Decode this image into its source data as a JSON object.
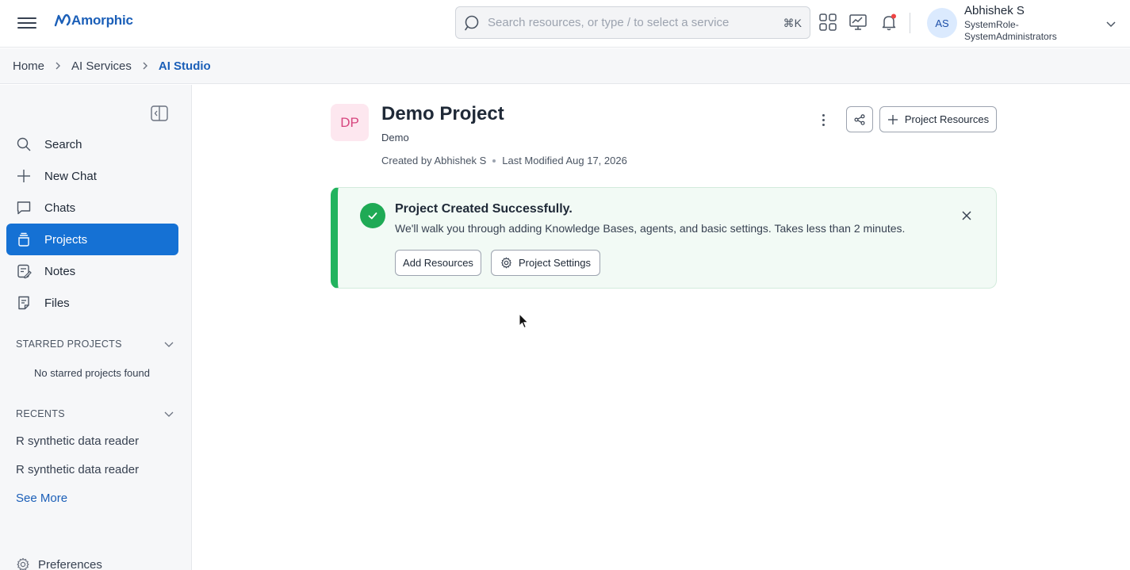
{
  "app": {
    "logo_text": "Amorphic",
    "brand_color": "#1b5fb8"
  },
  "header": {
    "search_placeholder": "Search resources, or type / to select a service",
    "search_shortcut": "⌘K",
    "icons": [
      "apps-grid-icon",
      "monitor-chart-icon",
      "bell-icon"
    ],
    "notification_dot_color": "#ef4444",
    "user": {
      "initials": "AS",
      "name": "Abhishek S",
      "role_line1": "SystemRole-",
      "role_line2": "SystemAdministrators"
    }
  },
  "breadcrumb": [
    "Home",
    "AI Services",
    "AI Studio"
  ],
  "sidebar": {
    "nav": [
      {
        "label": "Search",
        "icon": "search-icon"
      },
      {
        "label": "New Chat",
        "icon": "plus-icon"
      },
      {
        "label": "Chats",
        "icon": "chat-bubble-icon"
      },
      {
        "label": "Projects",
        "icon": "projects-icon",
        "active": true
      },
      {
        "label": "Notes",
        "icon": "notes-icon"
      },
      {
        "label": "Files",
        "icon": "files-icon"
      }
    ],
    "starred_heading": "STARRED PROJECTS",
    "starred_empty": "No starred projects found",
    "recents_heading": "RECENTS",
    "recents": [
      "R synthetic data reader",
      "R synthetic data reader"
    ],
    "see_more": "See More",
    "preferences": "Preferences",
    "active_color": "#1571d4"
  },
  "project": {
    "badge": "DP",
    "title": "Demo Project",
    "subtitle": "Demo",
    "created_by": "Created by Abhishek S",
    "last_modified": "Last Modified Aug 17, 2026",
    "resources_button": "Project Resources"
  },
  "banner": {
    "title": "Project Created Successfully.",
    "text": "We'll walk you through adding Knowledge Bases, agents, and basic settings. Takes less than 2 minutes.",
    "add_resources": "Add Resources",
    "project_settings": "Project Settings",
    "accent_color": "#22b35e"
  }
}
